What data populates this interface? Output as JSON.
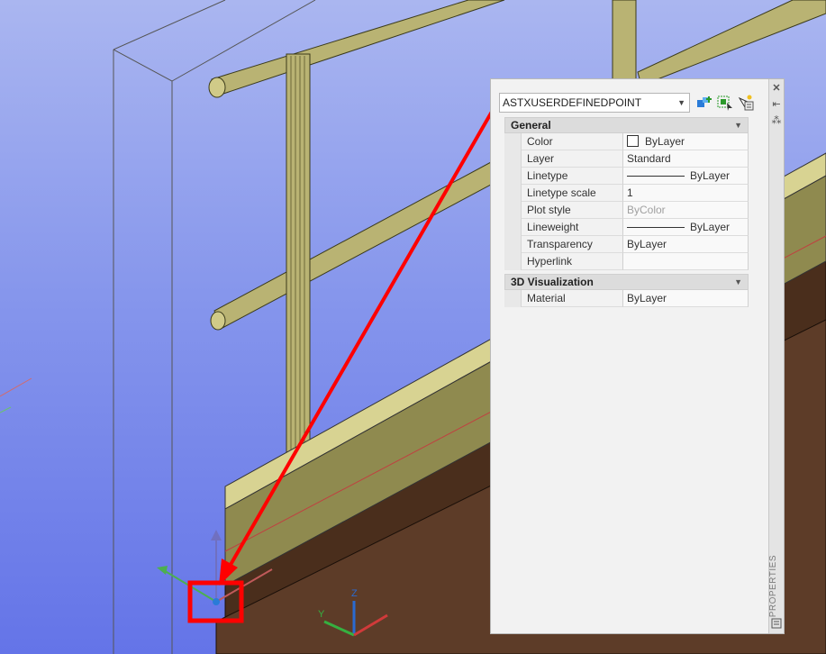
{
  "properties_palette": {
    "object_type": "ASTXUSERDEFINEDPOINT",
    "toolbar": {
      "quick_select_icon": "quick-select-icon",
      "select_objects_icon": "select-objects-icon",
      "toggle_pickadd_icon": "toggle-pickadd-icon"
    },
    "strip": {
      "close_icon": "close-icon",
      "autohide_icon": "autohide-icon",
      "properties_icon": "properties-menu-icon",
      "vertical_title": "PROPERTIES"
    },
    "sections": {
      "general": {
        "title": "General",
        "color": {
          "label": "Color",
          "value": "ByLayer"
        },
        "layer": {
          "label": "Layer",
          "value": "Standard"
        },
        "linetype": {
          "label": "Linetype",
          "value": "ByLayer"
        },
        "linetype_scale": {
          "label": "Linetype scale",
          "value": "1"
        },
        "plot_style": {
          "label": "Plot style",
          "value": "ByColor"
        },
        "lineweight": {
          "label": "Lineweight",
          "value": "ByLayer"
        },
        "transparency": {
          "label": "Transparency",
          "value": "ByLayer"
        },
        "hyperlink": {
          "label": "Hyperlink",
          "value": ""
        }
      },
      "visualization": {
        "title": "3D Visualization",
        "material": {
          "label": "Material",
          "value": "ByLayer"
        }
      }
    }
  },
  "ucs": {
    "y_label": "Y",
    "z_label": "Z"
  },
  "colors": {
    "highlight": "#ff0000",
    "rail": "#c7c07a",
    "beam": "#5a3a24"
  }
}
